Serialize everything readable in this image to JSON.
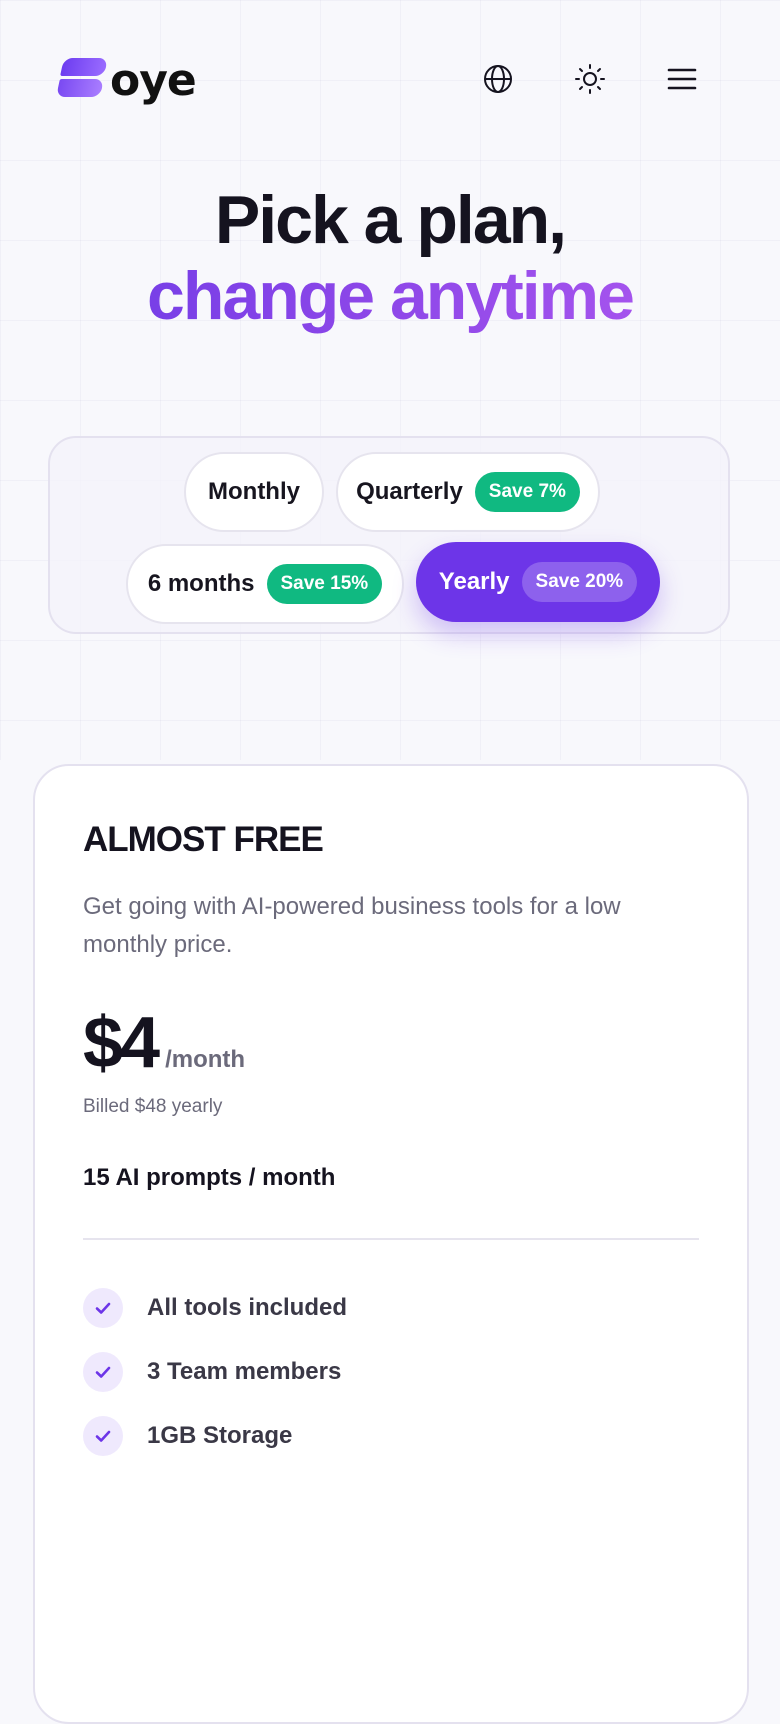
{
  "header": {
    "logo_text": "oye",
    "icons": [
      "globe-icon",
      "sun-icon",
      "menu-icon"
    ]
  },
  "hero": {
    "line1": "Pick a plan,",
    "line2": "change anytime"
  },
  "billing": {
    "options": [
      {
        "label": "Monthly",
        "badge": ""
      },
      {
        "label": "Quarterly",
        "badge": "Save 7%"
      },
      {
        "label": "6 months",
        "badge": "Save 15%"
      },
      {
        "label": "Yearly",
        "badge": "Save 20%"
      }
    ],
    "selected": "Yearly"
  },
  "plan": {
    "name": "ALMOST FREE",
    "description": "Get going with AI-powered business tools for a low monthly price.",
    "price": "$4",
    "period": "/month",
    "billed": "Billed $48 yearly",
    "prompts": "15 AI prompts / month",
    "features": [
      "All tools included",
      "3 Team members",
      "1GB Storage"
    ]
  },
  "colors": {
    "accent": "#6d35e8",
    "badge_green": "#10b981",
    "background": "#f8f8fc"
  }
}
